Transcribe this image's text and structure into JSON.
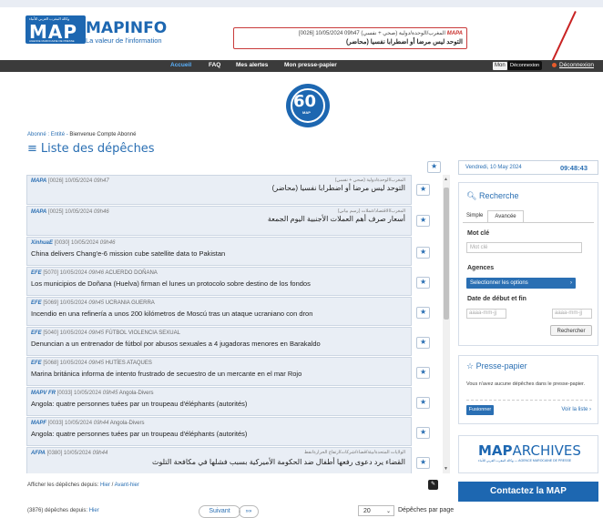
{
  "header": {
    "logo_text": "MAP",
    "logo_arabic": "وكالة المغرب العربي للأنباء",
    "logo_sub": "AGENCE MAROCAINE DE PRESSE",
    "brand": "MAPINFO",
    "tagline": "La valeur de l'information",
    "alert": {
      "agency": "MAPA",
      "meta": "[0026] 10/05/2024 09h47 المغرب/الوحدة/دولية (صحي + نفسي)",
      "headline": "التوحد ليس مرضا أو اضطرابا نفسيا (محاضر)"
    }
  },
  "nav": {
    "items": [
      "Accueil",
      "FAQ",
      "Mes alertes",
      "Mon presse-papier"
    ],
    "user_label": "Mon",
    "tooltip": "Déconnexion",
    "logout": "Déconnexion"
  },
  "anniversary": {
    "number": "60",
    "label": "MAP"
  },
  "breadcrumb": {
    "subscriber": "Abonné : Entité",
    "welcome": "Bienvenue Compte Abonné"
  },
  "page": {
    "title": "Liste des dépêches",
    "title_icon": "≡"
  },
  "dispatches": [
    {
      "agency": "MAPA",
      "code": "[0026]",
      "date": "10/05/2024",
      "time": "09h47",
      "tags": "",
      "tags_ar": "المغرب/الوحدة/دولية (صحي + نفسي)",
      "headline": "",
      "headline_ar": "التوحد ليس مرضا أو اضطرابا نفسيا (محاضر)"
    },
    {
      "agency": "MAPA",
      "code": "[0025]",
      "date": "10/05/2024",
      "time": "09h46",
      "tags": "",
      "tags_ar": "المغرب/الاقتصاد/عملات (رسم بياني)",
      "headline": "",
      "headline_ar": "أسعار صرف أهم العملات الأجنبية اليوم الجمعة"
    },
    {
      "agency": "XinhuaE",
      "code": "[0030]",
      "date": "10/05/2024",
      "time": "09h46",
      "tags": "",
      "tags_ar": "",
      "headline": "China delivers Chang'e-6 mission cube satellite data to Pakistan",
      "headline_ar": ""
    },
    {
      "agency": "EFE",
      "code": "[5070]",
      "date": "10/05/2024",
      "time": "09h46",
      "tags": "ACUERDO DOÑANA",
      "tags_ar": "",
      "headline": "Los municipios de Doñana (Huelva) firman el lunes un protocolo sobre destino de los fondos",
      "headline_ar": ""
    },
    {
      "agency": "EFE",
      "code": "[5069]",
      "date": "10/05/2024",
      "time": "09h45",
      "tags": "UCRANIA GUERRA",
      "tags_ar": "",
      "headline": "Incendio en una refinería a unos 200 kilómetros de Moscú tras un ataque ucraniano con dron",
      "headline_ar": ""
    },
    {
      "agency": "EFE",
      "code": "[5040]",
      "date": "10/05/2024",
      "time": "09h45",
      "tags": "FÚTBOL VIOLENCIA SEXUAL",
      "tags_ar": "",
      "headline": "Denuncian a un entrenador de fútbol por abusos sexuales a 4 jugadoras menores en Barakaldo",
      "headline_ar": ""
    },
    {
      "agency": "EFE",
      "code": "[5068]",
      "date": "10/05/2024",
      "time": "09h45",
      "tags": "HUTÍES ATAQUES",
      "tags_ar": "",
      "headline": "Marina británica informa de intento frustrado de secuestro de un mercante en el mar Rojo",
      "headline_ar": ""
    },
    {
      "agency": "MAPV FR",
      "code": "[0033]",
      "date": "10/05/2024",
      "time": "09h45",
      "tags": "Angola-Divers",
      "tags_ar": "",
      "headline": "Angola: quatre personnes tuées par un troupeau d'éléphants (autorités)",
      "headline_ar": ""
    },
    {
      "agency": "MAPF",
      "code": "[0033]",
      "date": "10/05/2024",
      "time": "09h44",
      "tags": "Angola-Divers",
      "tags_ar": "",
      "headline": "Angola: quatre personnes tuées par un troupeau d'éléphants (autorités)",
      "headline_ar": ""
    },
    {
      "agency": "AFPA",
      "code": "[0380]",
      "date": "10/05/2024",
      "time": "09h44",
      "tags": "",
      "tags_ar": "الولايات المتحدة/بيئة/قضاء/شركات/ارتفاع الحرارة/نفط",
      "headline": "",
      "headline_ar": "القضاء يرد دعوى رفعها أطفال ضد الحكومة الأميركية بسبب فشلها في مكافحة التلوث"
    }
  ],
  "list_footer": {
    "label": "Afficher les dépêches depuis:",
    "link_yesterday": "Hier",
    "sep": "/",
    "link_before": "Avant-hier"
  },
  "count": {
    "text": "(3876) dépêches depuis:",
    "link": "Hier"
  },
  "pager": {
    "next": "Suivant",
    "last": "»»",
    "per_page_value": "20",
    "per_page_label": "Dépêches par page"
  },
  "sidebar": {
    "date": "Vendredi, 10 May 2024",
    "clock": "09:48:43",
    "search": {
      "title": "Recherche",
      "tabs": [
        "Simple",
        "Avancée"
      ],
      "keyword_label": "Mot clé",
      "keyword_placeholder": "Mot clé",
      "agencies_label": "Agences",
      "agencies_select": "Selectionner les options",
      "dates_label": "Date de début et fin",
      "date_placeholder_start": "aaaa-mm-jj",
      "date_placeholder_end": "aaaa-mm-jj",
      "submit": "Rechercher"
    },
    "clipboard": {
      "title": "Presse-papier",
      "empty_text": "Vous n'avez aucune dépêches dans le presse-papier.",
      "merge": "Fusionner",
      "see_list": "Voir la liste"
    },
    "archives": {
      "brand_bold": "MAP",
      "brand_rest": "ARCHIVES",
      "sub": "وكالة المغرب العربي للأنباء — AGENCE MAROCAINE DE PRESSE"
    },
    "contact": "Contactez la MAP"
  },
  "colors": {
    "brand_blue": "#1d67b1",
    "link_blue": "#2a6fb3",
    "nav_bg": "#3b3b3b",
    "alert_red": "#c93b3b",
    "row_bg": "#e9eef5"
  }
}
